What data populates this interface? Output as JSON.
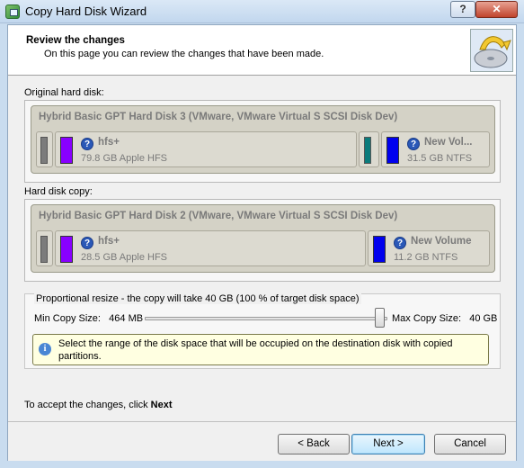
{
  "window": {
    "title": "Copy Hard Disk Wizard",
    "help_label": "?",
    "close_label": "✕"
  },
  "header": {
    "title": "Review the changes",
    "subtitle": "On this page you can review the changes that have been made."
  },
  "original": {
    "section_label": "Original hard disk:",
    "disk_title": "Hybrid Basic GPT Hard Disk 3 (VMware, VMware Virtual S SCSI Disk Dev)",
    "partitions": [
      {
        "name": "hfs+",
        "size": "79.8 GB Apple HFS",
        "color": "#8800ff"
      },
      {
        "name": "New Vol...",
        "size": "31.5 GB NTFS",
        "color": "#0000ee"
      }
    ]
  },
  "copy": {
    "section_label": "Hard disk copy:",
    "disk_title": "Hybrid Basic GPT Hard Disk 2 (VMware, VMware Virtual S SCSI Disk Dev)",
    "partitions": [
      {
        "name": "hfs+",
        "size": "28.5 GB Apple HFS",
        "color": "#8800ff"
      },
      {
        "name": "New Volume",
        "size": "11.2 GB NTFS",
        "color": "#0000ee"
      }
    ]
  },
  "resize": {
    "label": "Proportional resize - the copy will take 40 GB (100 % of target disk space)",
    "min_label": "Min Copy Size:",
    "min_value": "464 MB",
    "max_label": "Max Copy Size:",
    "max_value": "40 GB",
    "slider_fraction": 1.0,
    "info": "Select the range of the disk space that will be occupied on the destination disk with copied partitions."
  },
  "accept": {
    "prefix": "To accept the changes, click ",
    "keyword": "Next"
  },
  "buttons": {
    "back": "< Back",
    "next": "Next >",
    "cancel": "Cancel"
  },
  "icons": {
    "app": "copy-disk-wizard-icon",
    "help": "question-icon",
    "info": "info-icon",
    "logo": "disk-wizard-logo"
  }
}
